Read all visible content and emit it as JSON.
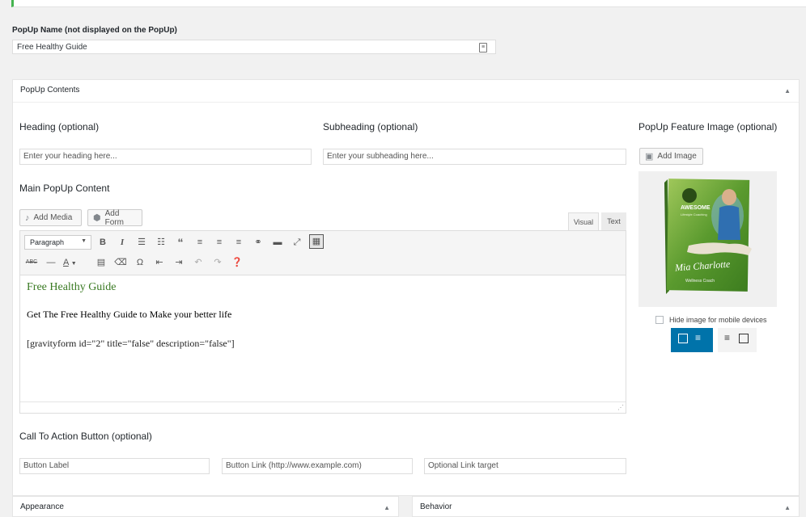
{
  "popup_name": {
    "label": "PopUp Name (not displayed on the PopUp)",
    "value": "Free Healthy Guide"
  },
  "contents_panel": {
    "title": "PopUp Contents",
    "heading": {
      "label": "Heading (optional)",
      "placeholder": "Enter your heading here..."
    },
    "subheading": {
      "label": "Subheading (optional)",
      "placeholder": "Enter your subheading here..."
    },
    "feature_image": {
      "label": "PopUp Feature Image (optional)",
      "add_image": "Add Image",
      "book_brand": "AWESOME",
      "book_brand_sub": "Lifestyle Coaching",
      "book_author": "Mia Charlotte",
      "book_role": "Wellness Coach",
      "hide_mobile_label": "Hide image for mobile devices"
    },
    "main_content": {
      "label": "Main PopUp Content",
      "add_media": "Add Media",
      "add_form": "Add Form",
      "tab_visual": "Visual",
      "tab_text": "Text",
      "format_select": "Paragraph",
      "content_heading": "Free Healthy Guide",
      "content_line": "Get The Free Healthy Guide to Make your better life",
      "content_shortcode": "[gravityform id=\"2\" title=\"false\" description=\"false\"]"
    },
    "cta": {
      "label": "Call To Action Button (optional)",
      "button_label_placeholder": "Button Label",
      "button_link_placeholder": "Button Link (http://www.example.com)",
      "link_target_placeholder": "Optional Link target"
    }
  },
  "appearance_panel": {
    "title": "Appearance"
  },
  "behavior_panel": {
    "title": "Behavior"
  },
  "colors": {
    "accent": "#0073aa",
    "green": "#46b450",
    "content_heading": "#3a7a23"
  }
}
